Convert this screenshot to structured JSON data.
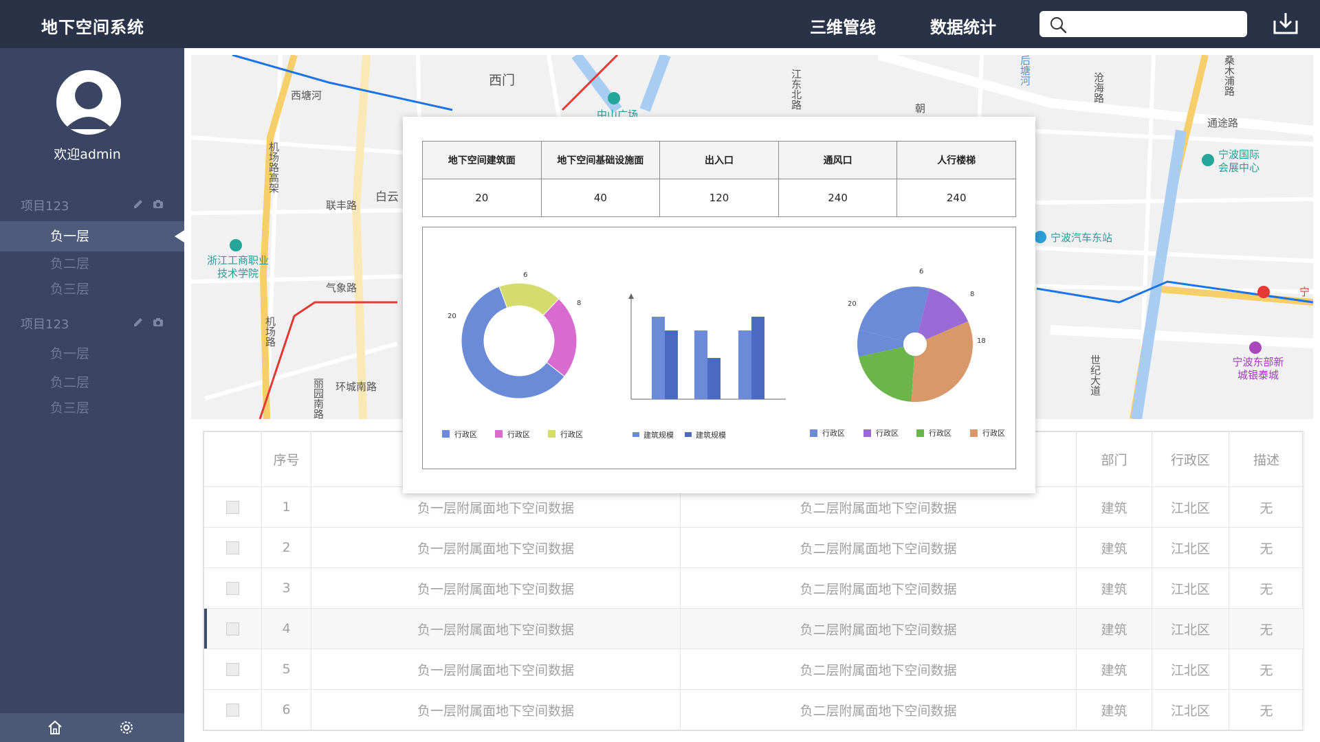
{
  "header": {
    "title": "地下空间系统",
    "nav": [
      "三维管线",
      "数据统计"
    ],
    "search_placeholder": "",
    "download_icon": "download-icon",
    "search_icon": "search-icon"
  },
  "sidebar": {
    "welcome": "欢迎admin",
    "projects": [
      {
        "name": "项目123",
        "floors": [
          "负一层",
          "负二层",
          "负三层"
        ]
      },
      {
        "name": "项目123",
        "floors": [
          "负一层",
          "负二层",
          "负三层"
        ]
      }
    ],
    "active_floor": "负一层",
    "footer_icons": [
      "home-icon",
      "settings-icon"
    ]
  },
  "map": {
    "labels": [
      "西门",
      "西塘河",
      "中山广场",
      "机场路高架",
      "联丰路",
      "白云",
      "浙江工商职业技术学院",
      "气象路",
      "机场路",
      "环城南路",
      "丽园南路",
      "江东北路",
      "后塘河",
      "沧海路",
      "朝",
      "桑木浦路",
      "通途路",
      "宁波国际会展中心",
      "宁波汽车东站",
      "宁",
      "宁波东部新城银泰城",
      "世纪大道"
    ]
  },
  "table": {
    "headers": [
      "",
      "序号",
      "",
      "",
      "部门",
      "行政区",
      "描述"
    ],
    "rows": [
      {
        "no": "1",
        "a": "负一层附属面地下空间数据",
        "b": "负二层附属面地下空间数据",
        "dept": "建筑",
        "district": "江北区",
        "desc": "无"
      },
      {
        "no": "2",
        "a": "负一层附属面地下空间数据",
        "b": "负二层附属面地下空间数据",
        "dept": "建筑",
        "district": "江北区",
        "desc": "无"
      },
      {
        "no": "3",
        "a": "负一层附属面地下空间数据",
        "b": "负二层附属面地下空间数据",
        "dept": "建筑",
        "district": "江北区",
        "desc": "无"
      },
      {
        "no": "4",
        "a": "负一层附属面地下空间数据",
        "b": "负二层附属面地下空间数据",
        "dept": "建筑",
        "district": "江北区",
        "desc": "无"
      },
      {
        "no": "5",
        "a": "负一层附属面地下空间数据",
        "b": "负二层附属面地下空间数据",
        "dept": "建筑",
        "district": "江北区",
        "desc": "无"
      },
      {
        "no": "6",
        "a": "负一层附属面地下空间数据",
        "b": "负二层附属面地下空间数据",
        "dept": "建筑",
        "district": "江北区",
        "desc": "无"
      }
    ],
    "highlight_row": 4
  },
  "stats": {
    "headers": [
      "地下空间建筑面",
      "地下空间基础设施面",
      "出入口",
      "通风口",
      "人行楼梯"
    ],
    "values": [
      "20",
      "40",
      "120",
      "240",
      "240"
    ]
  },
  "chart_data": [
    {
      "type": "pie",
      "variant": "donut",
      "slices": [
        {
          "label": "行政区",
          "value": 20,
          "color": "#6b8ad8"
        },
        {
          "label": "行政区",
          "value": 8,
          "color": "#d76bd0"
        },
        {
          "label": "行政区",
          "value": 6,
          "color": "#d4dc6e"
        }
      ]
    },
    {
      "type": "bar",
      "categories": [
        "",
        "",
        ""
      ],
      "series": [
        {
          "name": "建筑规模",
          "values": [
            6,
            5,
            5
          ],
          "color": "#6b8ad8"
        },
        {
          "name": "建筑规模",
          "values": [
            5,
            3,
            6
          ],
          "color": "#4a6bbf"
        }
      ],
      "ylim": [
        0,
        8
      ]
    },
    {
      "type": "pie",
      "variant": "ring",
      "slices": [
        {
          "label": "行政区",
          "value": 20,
          "color": "#6b8ad8"
        },
        {
          "label": "行政区",
          "value": 8,
          "color": "#9a6ad6"
        },
        {
          "label": "行政区",
          "value": 12,
          "color": "#6bb54a"
        },
        {
          "label": "行政区",
          "value": 18,
          "color": "#d8996a"
        }
      ],
      "data_labels": [
        "6",
        "8",
        "18",
        "20"
      ]
    }
  ]
}
